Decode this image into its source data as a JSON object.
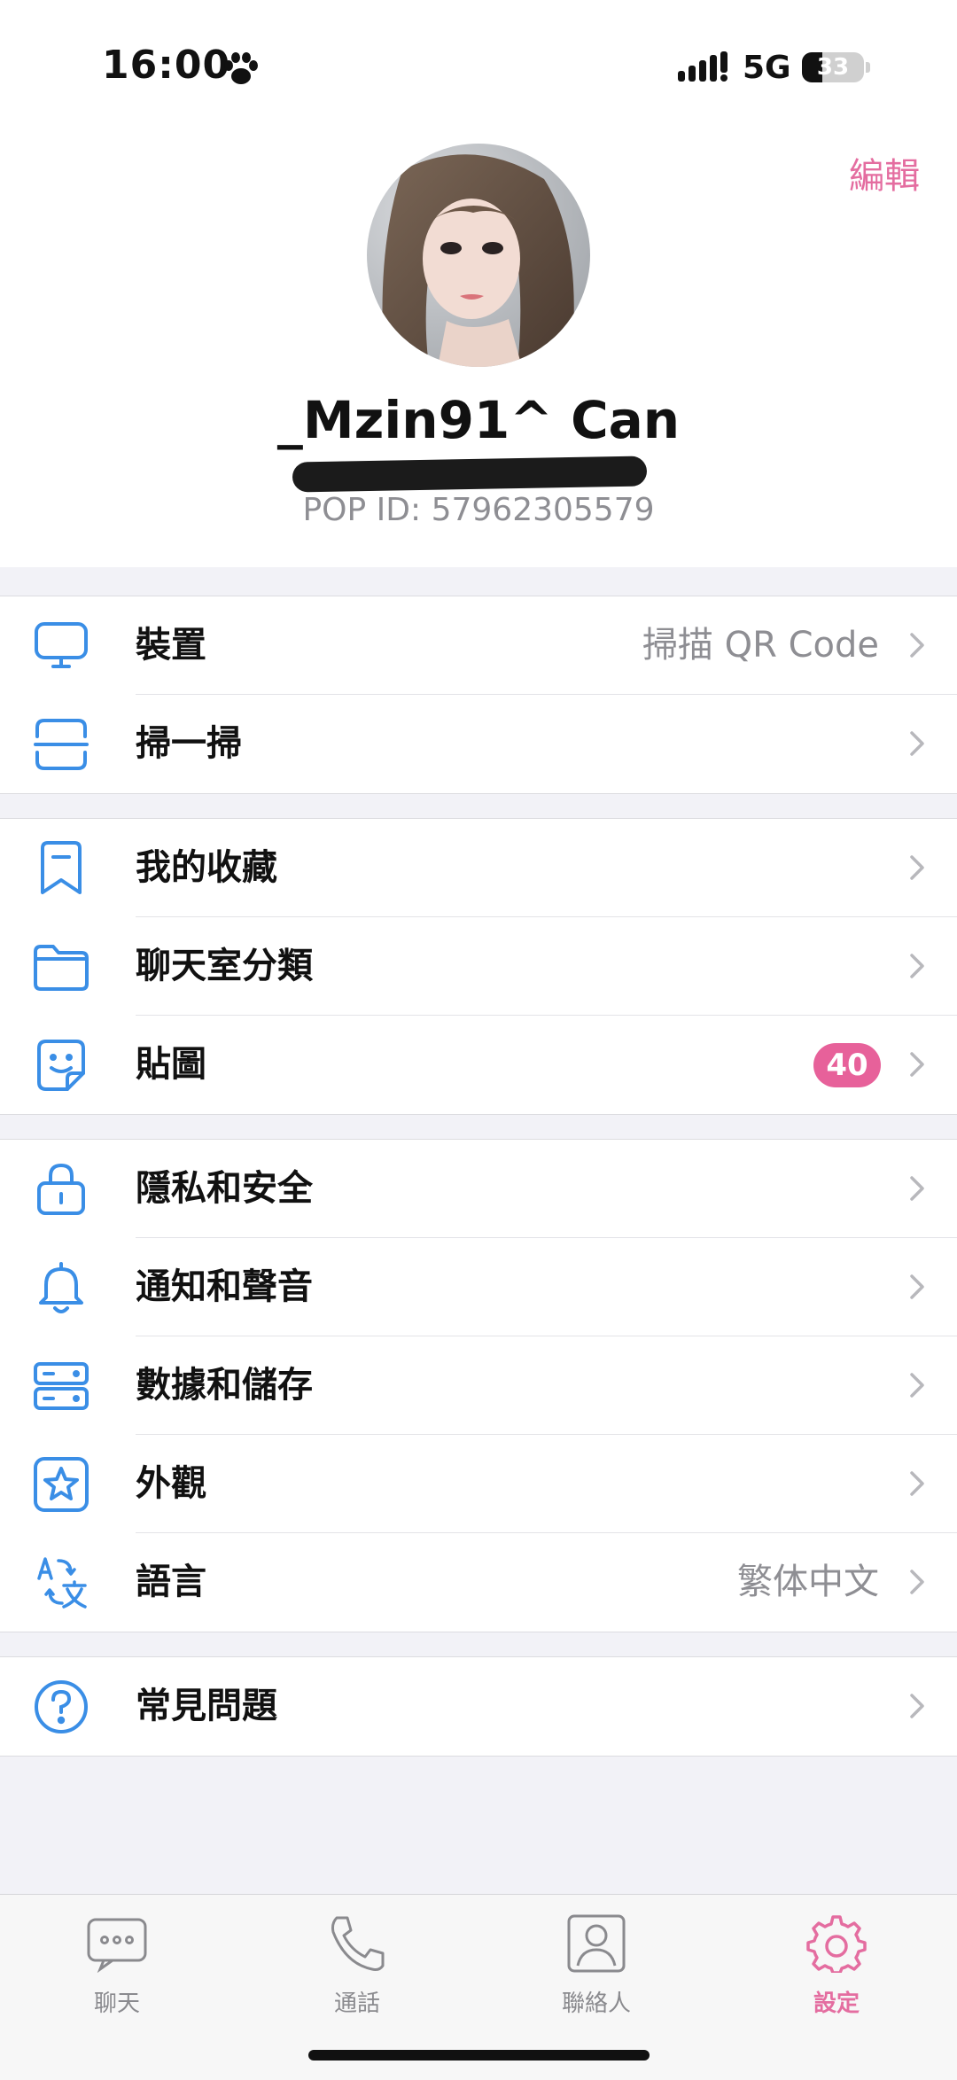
{
  "status_bar": {
    "time": "16:00",
    "network": "5G",
    "battery": "33",
    "battery_level": 0.33
  },
  "profile": {
    "edit_label": "編輯",
    "name": "_Mzin91^ Can",
    "pop_id": "POP ID: 57962305579"
  },
  "groups": [
    [
      {
        "name": "devices",
        "icon": "monitor-icon",
        "label": "裝置",
        "value": "掃描 QR Code"
      },
      {
        "name": "scan",
        "icon": "scan-icon",
        "label": "掃一掃"
      }
    ],
    [
      {
        "name": "favorites",
        "icon": "bookmark-icon",
        "label": "我的收藏"
      },
      {
        "name": "chat-folders",
        "icon": "folder-icon",
        "label": "聊天室分類"
      },
      {
        "name": "stickers",
        "icon": "sticker-icon",
        "label": "貼圖",
        "badge": "40"
      }
    ],
    [
      {
        "name": "privacy",
        "icon": "lock-icon",
        "label": "隱私和安全"
      },
      {
        "name": "notifications",
        "icon": "bell-icon",
        "label": "通知和聲音"
      },
      {
        "name": "data-storage",
        "icon": "storage-icon",
        "label": "數據和儲存"
      },
      {
        "name": "appearance",
        "icon": "star-icon",
        "label": "外觀"
      },
      {
        "name": "language",
        "icon": "translate-icon",
        "label": "語言",
        "value": "繁体中文"
      }
    ],
    [
      {
        "name": "faq",
        "icon": "question-icon",
        "label": "常見問題"
      }
    ]
  ],
  "tabs": [
    {
      "name": "chats",
      "icon": "chat-bubble-icon",
      "label": "聊天",
      "active": false
    },
    {
      "name": "calls",
      "icon": "phone-icon",
      "label": "通話",
      "active": false
    },
    {
      "name": "contacts",
      "icon": "contacts-icon",
      "label": "聯絡人",
      "active": false
    },
    {
      "name": "settings",
      "icon": "gear-icon",
      "label": "設定",
      "active": true
    }
  ],
  "colors": {
    "accent": "#e46da0",
    "icon_blue": "#3a8ee6",
    "badge": "#e7619a",
    "secondary_text": "#8e8e93",
    "background": "#f2f2f7"
  }
}
